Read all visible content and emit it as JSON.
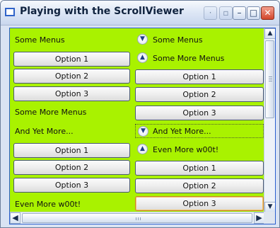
{
  "window": {
    "title": "Playing with the ScrollViewer",
    "icons": {
      "app": "window-icon",
      "help": "help-icon",
      "extra": "settings-icon",
      "minimize": "minimize-icon",
      "maximize": "maximize-icon",
      "close": "close-icon"
    },
    "glyphs": {
      "minimize": "–",
      "maximize": "□",
      "close": "✕"
    }
  },
  "left_column": {
    "header1": "Some Menus",
    "header2": "Some More Menus",
    "header3": "And Yet More...",
    "header4": "Even More w00t!",
    "group1": [
      "Option 1",
      "Option 2",
      "Option 3"
    ],
    "group2": [
      "Option 1",
      "Option 2",
      "Option 3"
    ]
  },
  "right_column": {
    "expander1": {
      "label": "Some Menus",
      "state": "collapsed",
      "icon": "chevron-down-icon"
    },
    "expander2": {
      "label": "Some More Menus",
      "state": "expanded",
      "icon": "chevron-up-icon",
      "options": [
        "Option 1",
        "Option 2",
        "Option 3"
      ]
    },
    "expander3": {
      "label": "And Yet More...",
      "state": "collapsed",
      "icon": "chevron-down-icon"
    },
    "expander4": {
      "label": "Even More w00t!",
      "state": "expanded",
      "icon": "chevron-up-icon",
      "options": [
        "Option 1",
        "Option 2",
        "Option 3"
      ]
    }
  },
  "scroll": {
    "vertical_position": 0.0,
    "horizontal_position": 0.0,
    "arrows": {
      "up": "▲",
      "down": "▼",
      "left": "◀",
      "right": "▶"
    }
  },
  "colors": {
    "content_background": "#a9f200",
    "accent_border": "#2b5fcf"
  }
}
